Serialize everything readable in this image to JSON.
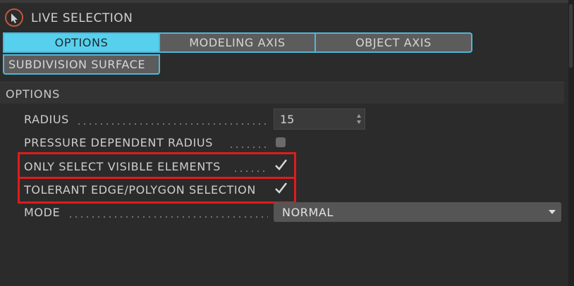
{
  "panel": {
    "title": "LIVE SELECTION",
    "tool_icon": "live-selection-arrow-icon"
  },
  "tabs": [
    {
      "label": "OPTIONS",
      "active": true
    },
    {
      "label": "MODELING AXIS",
      "active": false
    },
    {
      "label": "OBJECT AXIS",
      "active": false
    },
    {
      "label": "SUBDIVISION SURFACE",
      "active": false
    }
  ],
  "section": {
    "title": "OPTIONS"
  },
  "fields": {
    "radius": {
      "label": "RADIUS",
      "value": "15"
    },
    "pressure": {
      "label": "PRESSURE DEPENDENT RADIUS",
      "checked": false
    },
    "only_visible": {
      "label": "ONLY SELECT VISIBLE ELEMENTS",
      "checked": true
    },
    "tolerant": {
      "label": "TOLERANT EDGE/POLYGON SELECTION",
      "checked": true
    },
    "mode": {
      "label": "MODE",
      "value": "NORMAL"
    }
  },
  "colors": {
    "active_tab": "#57d0ee",
    "highlight": "#e01b1b",
    "background": "#2b2b2b"
  }
}
